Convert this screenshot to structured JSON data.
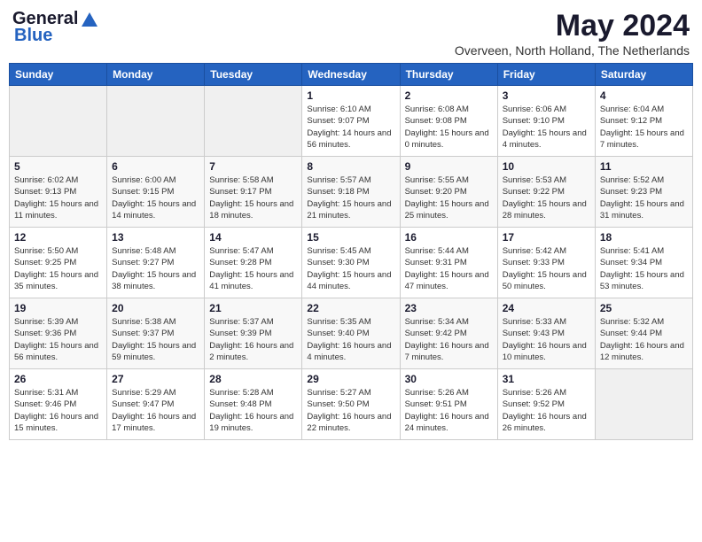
{
  "logo": {
    "general": "General",
    "blue": "Blue"
  },
  "title": "May 2024",
  "location": "Overveen, North Holland, The Netherlands",
  "days_of_week": [
    "Sunday",
    "Monday",
    "Tuesday",
    "Wednesday",
    "Thursday",
    "Friday",
    "Saturday"
  ],
  "weeks": [
    [
      {
        "num": "",
        "empty": true
      },
      {
        "num": "",
        "empty": true
      },
      {
        "num": "",
        "empty": true
      },
      {
        "num": "1",
        "sunrise": "6:10 AM",
        "sunset": "9:07 PM",
        "daylight": "14 hours and 56 minutes."
      },
      {
        "num": "2",
        "sunrise": "6:08 AM",
        "sunset": "9:08 PM",
        "daylight": "15 hours and 0 minutes."
      },
      {
        "num": "3",
        "sunrise": "6:06 AM",
        "sunset": "9:10 PM",
        "daylight": "15 hours and 4 minutes."
      },
      {
        "num": "4",
        "sunrise": "6:04 AM",
        "sunset": "9:12 PM",
        "daylight": "15 hours and 7 minutes."
      }
    ],
    [
      {
        "num": "5",
        "sunrise": "6:02 AM",
        "sunset": "9:13 PM",
        "daylight": "15 hours and 11 minutes."
      },
      {
        "num": "6",
        "sunrise": "6:00 AM",
        "sunset": "9:15 PM",
        "daylight": "15 hours and 14 minutes."
      },
      {
        "num": "7",
        "sunrise": "5:58 AM",
        "sunset": "9:17 PM",
        "daylight": "15 hours and 18 minutes."
      },
      {
        "num": "8",
        "sunrise": "5:57 AM",
        "sunset": "9:18 PM",
        "daylight": "15 hours and 21 minutes."
      },
      {
        "num": "9",
        "sunrise": "5:55 AM",
        "sunset": "9:20 PM",
        "daylight": "15 hours and 25 minutes."
      },
      {
        "num": "10",
        "sunrise": "5:53 AM",
        "sunset": "9:22 PM",
        "daylight": "15 hours and 28 minutes."
      },
      {
        "num": "11",
        "sunrise": "5:52 AM",
        "sunset": "9:23 PM",
        "daylight": "15 hours and 31 minutes."
      }
    ],
    [
      {
        "num": "12",
        "sunrise": "5:50 AM",
        "sunset": "9:25 PM",
        "daylight": "15 hours and 35 minutes."
      },
      {
        "num": "13",
        "sunrise": "5:48 AM",
        "sunset": "9:27 PM",
        "daylight": "15 hours and 38 minutes."
      },
      {
        "num": "14",
        "sunrise": "5:47 AM",
        "sunset": "9:28 PM",
        "daylight": "15 hours and 41 minutes."
      },
      {
        "num": "15",
        "sunrise": "5:45 AM",
        "sunset": "9:30 PM",
        "daylight": "15 hours and 44 minutes."
      },
      {
        "num": "16",
        "sunrise": "5:44 AM",
        "sunset": "9:31 PM",
        "daylight": "15 hours and 47 minutes."
      },
      {
        "num": "17",
        "sunrise": "5:42 AM",
        "sunset": "9:33 PM",
        "daylight": "15 hours and 50 minutes."
      },
      {
        "num": "18",
        "sunrise": "5:41 AM",
        "sunset": "9:34 PM",
        "daylight": "15 hours and 53 minutes."
      }
    ],
    [
      {
        "num": "19",
        "sunrise": "5:39 AM",
        "sunset": "9:36 PM",
        "daylight": "15 hours and 56 minutes."
      },
      {
        "num": "20",
        "sunrise": "5:38 AM",
        "sunset": "9:37 PM",
        "daylight": "15 hours and 59 minutes."
      },
      {
        "num": "21",
        "sunrise": "5:37 AM",
        "sunset": "9:39 PM",
        "daylight": "16 hours and 2 minutes."
      },
      {
        "num": "22",
        "sunrise": "5:35 AM",
        "sunset": "9:40 PM",
        "daylight": "16 hours and 4 minutes."
      },
      {
        "num": "23",
        "sunrise": "5:34 AM",
        "sunset": "9:42 PM",
        "daylight": "16 hours and 7 minutes."
      },
      {
        "num": "24",
        "sunrise": "5:33 AM",
        "sunset": "9:43 PM",
        "daylight": "16 hours and 10 minutes."
      },
      {
        "num": "25",
        "sunrise": "5:32 AM",
        "sunset": "9:44 PM",
        "daylight": "16 hours and 12 minutes."
      }
    ],
    [
      {
        "num": "26",
        "sunrise": "5:31 AM",
        "sunset": "9:46 PM",
        "daylight": "16 hours and 15 minutes."
      },
      {
        "num": "27",
        "sunrise": "5:29 AM",
        "sunset": "9:47 PM",
        "daylight": "16 hours and 17 minutes."
      },
      {
        "num": "28",
        "sunrise": "5:28 AM",
        "sunset": "9:48 PM",
        "daylight": "16 hours and 19 minutes."
      },
      {
        "num": "29",
        "sunrise": "5:27 AM",
        "sunset": "9:50 PM",
        "daylight": "16 hours and 22 minutes."
      },
      {
        "num": "30",
        "sunrise": "5:26 AM",
        "sunset": "9:51 PM",
        "daylight": "16 hours and 24 minutes."
      },
      {
        "num": "31",
        "sunrise": "5:26 AM",
        "sunset": "9:52 PM",
        "daylight": "16 hours and 26 minutes."
      },
      {
        "num": "",
        "empty": true
      }
    ]
  ],
  "labels": {
    "sunrise": "Sunrise:",
    "sunset": "Sunset:",
    "daylight": "Daylight hours"
  }
}
